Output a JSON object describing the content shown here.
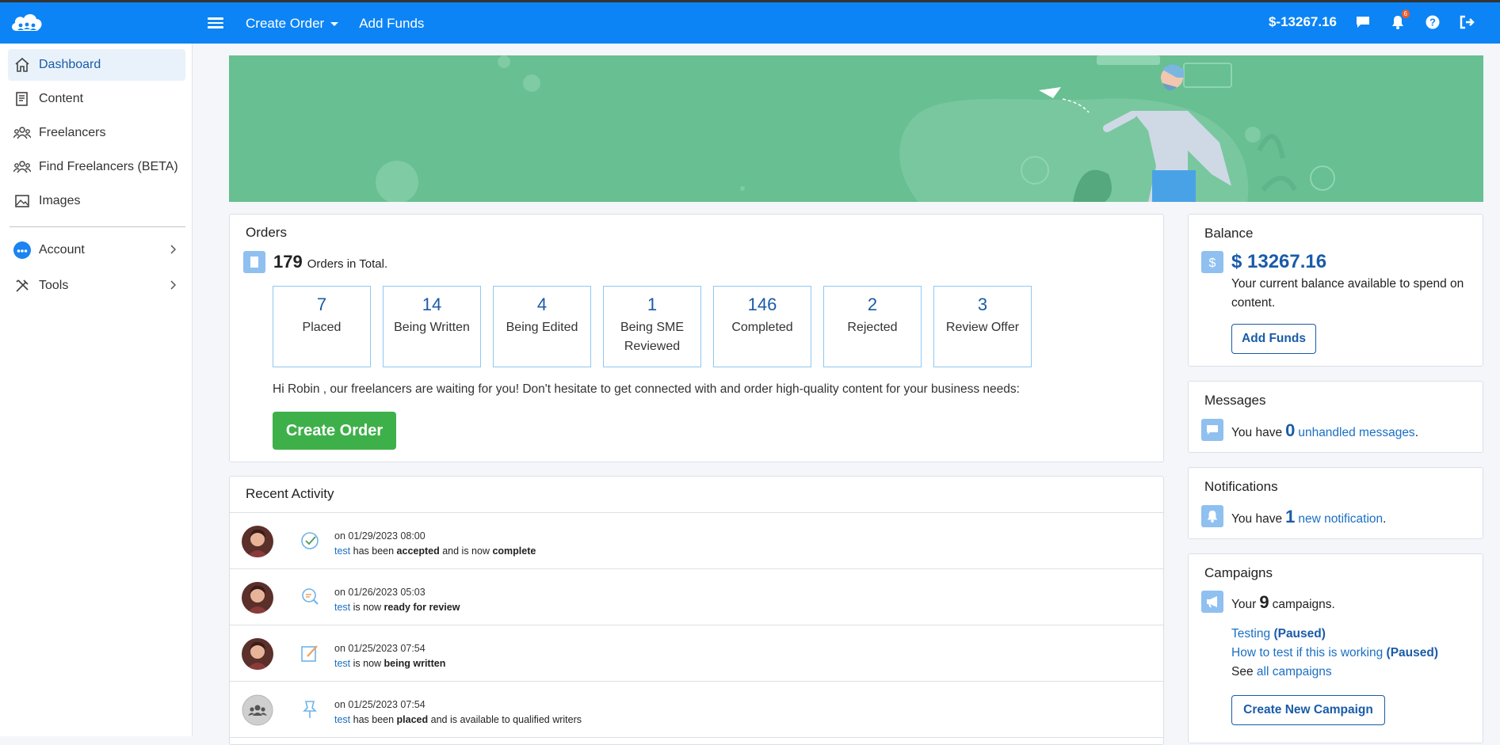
{
  "topbar": {
    "nav": [
      {
        "label": "Create Order",
        "has_dropdown": true
      },
      {
        "label": "Add Funds",
        "has_dropdown": false
      }
    ],
    "balance": "$-13267.16",
    "notification_badge": "6",
    "icons": [
      "chat-icon",
      "bell-icon",
      "help-icon",
      "logout-icon"
    ]
  },
  "sidebar": {
    "items": [
      {
        "label": "Dashboard",
        "icon": "home-icon",
        "active": true
      },
      {
        "label": "Content",
        "icon": "document-icon"
      },
      {
        "label": "Freelancers",
        "icon": "users-icon"
      },
      {
        "label": "Find Freelancers (BETA)",
        "icon": "users-icon"
      },
      {
        "label": "Images",
        "icon": "image-icon"
      },
      {
        "label": "Account",
        "icon": "account-cloud-icon",
        "expandable": true
      },
      {
        "label": "Tools",
        "icon": "tools-icon",
        "expandable": true
      }
    ]
  },
  "orders": {
    "title": "Orders",
    "total": "179",
    "total_label": "Orders in Total.",
    "stats": [
      {
        "value": "7",
        "label": "Placed"
      },
      {
        "value": "14",
        "label": "Being Written"
      },
      {
        "value": "4",
        "label": "Being Edited"
      },
      {
        "value": "1",
        "label": "Being SME Reviewed"
      },
      {
        "value": "146",
        "label": "Completed"
      },
      {
        "value": "2",
        "label": "Rejected"
      },
      {
        "value": "3",
        "label": "Review Offer"
      }
    ],
    "message": "Hi Robin , our freelancers are waiting for you! Don't hesitate to get connected with and order high-quality content for your business needs:",
    "button": "Create Order"
  },
  "activity": {
    "title": "Recent Activity",
    "rows": [
      {
        "date": "on 01/29/2023 08:00",
        "link": "test",
        "pre": " has been ",
        "bold1": "accepted",
        "mid": " and is now ",
        "bold2": "complete",
        "post": "",
        "icon": "check-circle-icon",
        "avatar": "user-photo"
      },
      {
        "date": "on 01/26/2023 05:03",
        "link": "test",
        "pre": " is now ",
        "bold1": "ready for review",
        "mid": "",
        "bold2": "",
        "post": "",
        "icon": "search-review-icon",
        "avatar": "user-photo"
      },
      {
        "date": "on 01/25/2023 07:54",
        "link": "test",
        "pre": " is now ",
        "bold1": "being written",
        "mid": "",
        "bold2": "",
        "post": "",
        "icon": "edit-icon",
        "avatar": "user-photo"
      },
      {
        "date": "on 01/25/2023 07:54",
        "link": "test",
        "pre": " has been ",
        "bold1": "placed",
        "mid": " and is available to qualified writers",
        "bold2": "",
        "post": "",
        "icon": "pin-icon",
        "avatar": "group-avatar"
      }
    ]
  },
  "balance": {
    "title": "Balance",
    "amount": "$ 13267.16",
    "description": "Your current balance available to spend on content.",
    "button": "Add Funds"
  },
  "messages": {
    "title": "Messages",
    "pre": "You have",
    "count": "0",
    "link": "unhandled messages",
    "post": "."
  },
  "notifications": {
    "title": "Notifications",
    "pre": "You have",
    "count": "1",
    "link": "new notification",
    "post": "."
  },
  "campaigns": {
    "title": "Campaigns",
    "pre": "Your",
    "count": "9",
    "post": "campaigns.",
    "items": [
      {
        "name": "Testing",
        "status": "(Paused)"
      },
      {
        "name": "How to test if this is working",
        "status": "(Paused)"
      }
    ],
    "see_pre": "See",
    "see_link": "all campaigns",
    "button": "Create New Campaign"
  },
  "colors": {
    "topbar": "#0c84f5",
    "accent": "#1a5ba8",
    "banner": "#67bf92",
    "green_button": "#3eb04a",
    "badge": "#f05a28"
  }
}
